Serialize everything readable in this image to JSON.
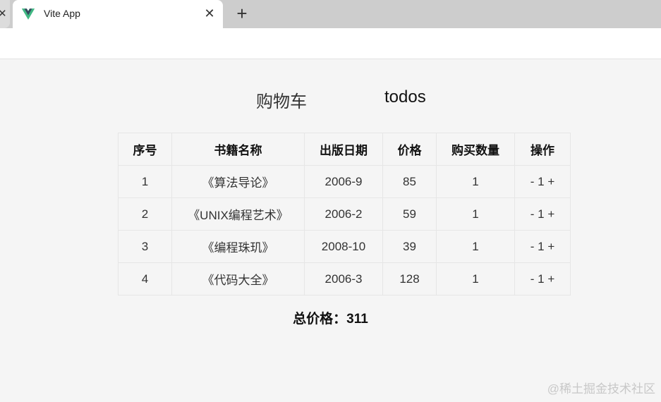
{
  "browser": {
    "tab_title": "Vite App",
    "tab_close": "✕",
    "prev_tab_close": "✕",
    "new_tab": "+"
  },
  "nav": {
    "cart": "购物车",
    "todos": "todos"
  },
  "table": {
    "headers": [
      "序号",
      "书籍名称",
      "出版日期",
      "价格",
      "购买数量",
      "操作"
    ],
    "rows": [
      {
        "id": "1",
        "name": "《算法导论》",
        "date": "2006-9",
        "price": "85",
        "count": "1"
      },
      {
        "id": "2",
        "name": "《UNIX编程艺术》",
        "date": "2006-2",
        "price": "59",
        "count": "1"
      },
      {
        "id": "3",
        "name": "《编程珠玑》",
        "date": "2008-10",
        "price": "39",
        "count": "1"
      },
      {
        "id": "4",
        "name": "《代码大全》",
        "date": "2006-3",
        "price": "128",
        "count": "1"
      }
    ],
    "minus": "-",
    "plus": "+"
  },
  "total": {
    "label": "总价格：",
    "value": "311"
  },
  "watermark": "@稀土掘金技术社区",
  "colors": {
    "vue_green": "#41b883",
    "vue_dark": "#34495e"
  }
}
